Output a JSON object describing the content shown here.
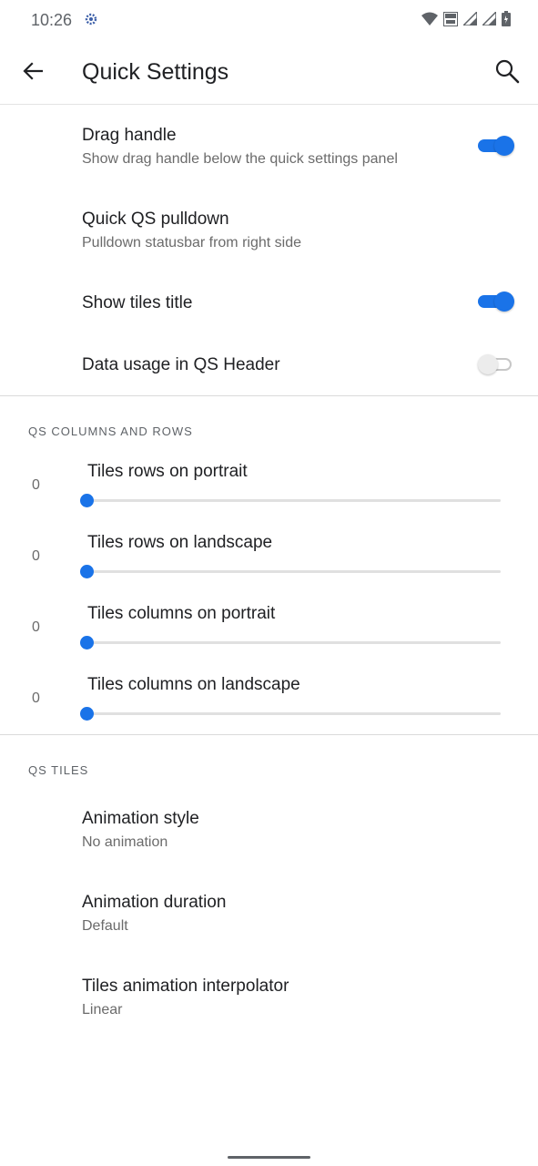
{
  "status_bar": {
    "time": "10:26"
  },
  "app_bar": {
    "title": "Quick Settings"
  },
  "prefs_top": [
    {
      "title": "Drag handle",
      "summary": "Show drag handle below the quick settings panel",
      "switch": "on"
    },
    {
      "title": "Quick QS pulldown",
      "summary": "Pulldown statusbar from right side"
    },
    {
      "title": "Show tiles title",
      "switch": "on"
    },
    {
      "title": "Data usage in QS Header",
      "switch": "off"
    }
  ],
  "section_columns": {
    "header": "QS COLUMNS AND ROWS"
  },
  "sliders": [
    {
      "title": "Tiles rows on portrait",
      "value": "0"
    },
    {
      "title": "Tiles rows on landscape",
      "value": "0"
    },
    {
      "title": "Tiles columns on portrait",
      "value": "0"
    },
    {
      "title": "Tiles columns on landscape",
      "value": "0"
    }
  ],
  "section_tiles": {
    "header": "QS TILES"
  },
  "prefs_tiles": [
    {
      "title": "Animation style",
      "summary": "No animation"
    },
    {
      "title": "Animation duration",
      "summary": "Default"
    },
    {
      "title": "Tiles animation interpolator",
      "summary": "Linear"
    }
  ],
  "colors": {
    "accent": "#1a73e8"
  },
  "icons": [
    "settings-gear-icon",
    "wifi-icon",
    "volte-icon",
    "signal-icon",
    "battery-icon",
    "back-arrow-icon",
    "search-icon"
  ]
}
